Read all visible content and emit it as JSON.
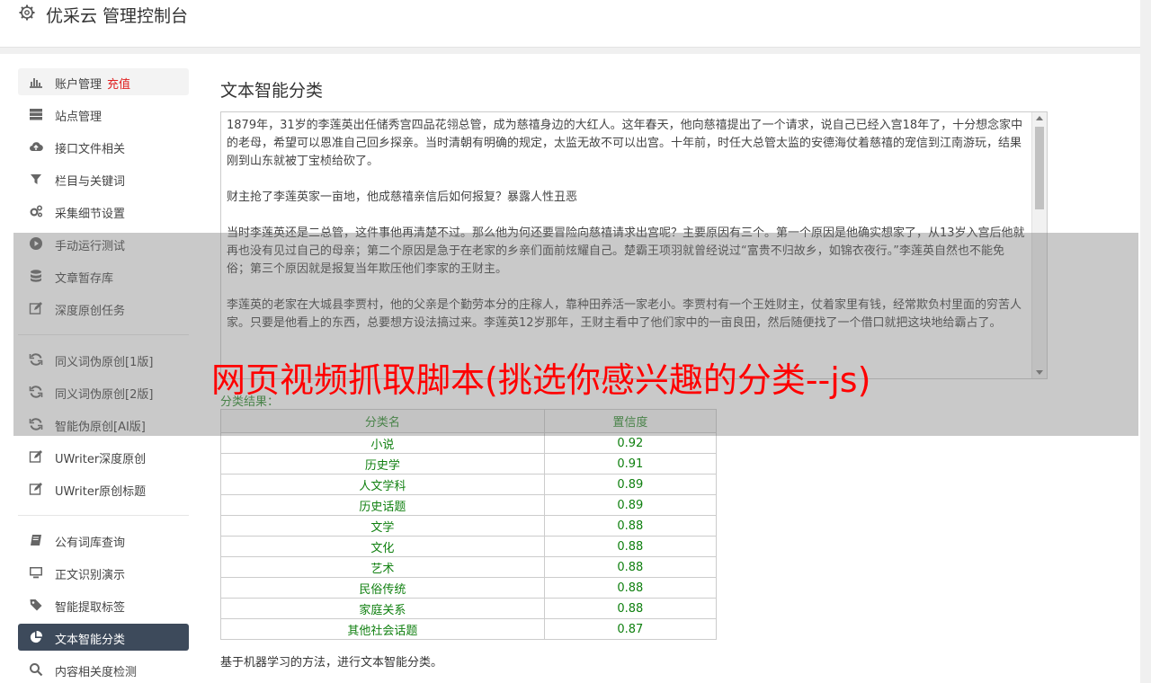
{
  "app": {
    "title": "优采云 管理控制台"
  },
  "sidebar": {
    "items": [
      {
        "label": "账户管理",
        "extra": "充值"
      },
      {
        "label": "站点管理"
      },
      {
        "label": "接口文件相关"
      },
      {
        "label": "栏目与关键词"
      },
      {
        "label": "采集细节设置"
      },
      {
        "label": "手动运行测试"
      },
      {
        "label": "文章暂存库"
      },
      {
        "label": "深度原创任务"
      },
      {
        "label": "同义词伪原创[1版]"
      },
      {
        "label": "同义词伪原创[2版]"
      },
      {
        "label": "智能伪原创[AI版]"
      },
      {
        "label": "UWriter深度原创"
      },
      {
        "label": "UWriter原创标题"
      },
      {
        "label": "公有词库查询"
      },
      {
        "label": "正文识别演示"
      },
      {
        "label": "智能提取标签"
      },
      {
        "label": "文本智能分类"
      },
      {
        "label": "内容相关度检测"
      }
    ]
  },
  "main": {
    "title": "文本智能分类",
    "textarea_value": "1879年，31岁的李莲英出任储秀宫四品花翎总管，成为慈禧身边的大红人。这年春天，他向慈禧提出了一个请求，说自己已经入宫18年了，十分想念家中的老母，希望可以恩准自己回乡探亲。当时清朝有明确的规定，太监无故不可以出宫。十年前，时任大总管太监的安德海仗着慈禧的宠信到江南游玩，结果刚到山东就被丁宝桢给砍了。\n\n财主抢了李莲英家一亩地，他成慈禧亲信后如何报复？暴露人性丑恶\n\n当时李莲英还是二总管，这件事他再清楚不过。那么他为何还要冒险向慈禧请求出宫呢？主要原因有三个。第一个原因是他确实想家了，从13岁入宫后他就再也没有见过自己的母亲；第二个原因是急于在老家的乡亲们面前炫耀自己。楚霸王项羽就曾经说过“富贵不归故乡，如锦衣夜行。”李莲英自然也不能免俗；第三个原因就是报复当年欺压他们李家的王财主。\n\n李莲英的老家在大城县李贾村，他的父亲是个勤劳本分的庄稼人，靠种田养活一家老小。李贾村有一个王姓财主，仗着家里有钱，经常欺负村里面的穷苦人家。只要是他看上的东西，总要想方设法搞过来。李莲英12岁那年，王财主看中了他们家中的一亩良田，然后随便找了一个借口就把这块地给霸占了。",
    "result_label": "分类结果：",
    "table": {
      "headers": [
        "分类名",
        "置信度"
      ],
      "rows": [
        [
          "小说",
          "0.92"
        ],
        [
          "历史学",
          "0.91"
        ],
        [
          "人文学科",
          "0.89"
        ],
        [
          "历史话题",
          "0.89"
        ],
        [
          "文学",
          "0.88"
        ],
        [
          "文化",
          "0.88"
        ],
        [
          "艺术",
          "0.88"
        ],
        [
          "民俗传统",
          "0.88"
        ],
        [
          "家庭关系",
          "0.88"
        ],
        [
          "其他社会话题",
          "0.87"
        ]
      ]
    },
    "footer_text": "基于机器学习的方法，进行文本智能分类。"
  },
  "overlay": {
    "text": "网页视频抓取脚本(挑选你感兴趣的分类--js)"
  },
  "colors": {
    "active_nav_bg": "#3d4a5b",
    "result_green": "#108010",
    "recharge_red": "#e02020",
    "overlay_red": "#ff0000"
  }
}
